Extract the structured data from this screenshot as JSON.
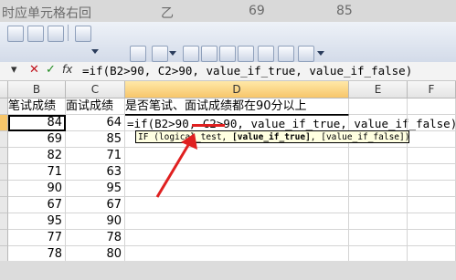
{
  "ghost_strip": {
    "left_text": "时应单元格右回",
    "mid_text": "乙",
    "num1": "69",
    "num2": "85"
  },
  "formula_bar": {
    "name_box_arrow": "▾",
    "cancel_icon": "✕",
    "enter_icon": "✓",
    "fx_label": "fx",
    "formula": "=if(B2>90, C2>90, value_if_true, value_if_false)"
  },
  "columns": [
    "B",
    "C",
    "D",
    "E",
    "F"
  ],
  "header_row": {
    "B": "笔试成绩",
    "C": "面试成绩",
    "D": "是否笔试、面试成绩都在90分以上"
  },
  "rows": [
    {
      "B": "84",
      "C": "64"
    },
    {
      "B": "69",
      "C": "85"
    },
    {
      "B": "82",
      "C": "71"
    },
    {
      "B": "71",
      "C": "63"
    },
    {
      "B": "90",
      "C": "95"
    },
    {
      "B": "67",
      "C": "67"
    },
    {
      "B": "95",
      "C": "90"
    },
    {
      "B": "77",
      "C": "78"
    },
    {
      "B": "78",
      "C": "80"
    }
  ],
  "editing_cell_text": "=if(B2>90, C2>90, value_if_true, value_if_false)",
  "tooltip": {
    "func": "IF",
    "arg1": "(logical_test,",
    "arg2": "[value_if_true]",
    "arg3": ", [value_if_false])"
  },
  "colors": {
    "arrow": "#e02020",
    "header_active": "#f7c66a",
    "tooltip_bg": "#ffffe1"
  }
}
